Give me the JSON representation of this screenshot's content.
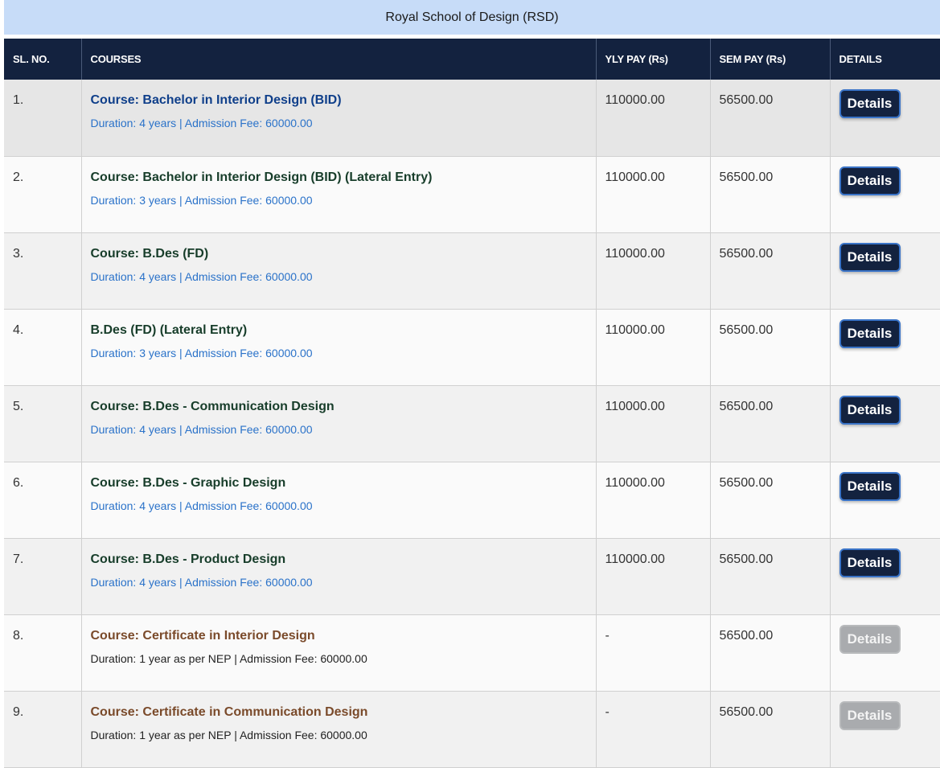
{
  "page": {
    "title": "Royal School of Design (RSD)"
  },
  "table": {
    "headers": [
      "SL. NO.",
      "COURSES",
      "YLY PAY (Rs)",
      "SEM PAY (Rs)",
      "DETAILS"
    ],
    "details_label": "Details",
    "rows": [
      {
        "sl": "1.",
        "course": "Course: Bachelor in Interior Design (BID)",
        "info": "Duration: 4 years | Admission Fee: 60000.00",
        "yly": "110000.00",
        "sem": "56500.00",
        "enabled": true
      },
      {
        "sl": "2.",
        "course": "Course: Bachelor in Interior Design (BID) (Lateral Entry)",
        "info": "Duration: 3 years | Admission Fee: 60000.00",
        "yly": "110000.00",
        "sem": "56500.00",
        "enabled": true
      },
      {
        "sl": "3.",
        "course": "Course: B.Des (FD)",
        "info": "Duration: 4 years | Admission Fee: 60000.00",
        "yly": "110000.00",
        "sem": "56500.00",
        "enabled": true
      },
      {
        "sl": "4.",
        "course": "B.Des (FD) (Lateral Entry)",
        "info": "Duration: 3 years | Admission Fee: 60000.00",
        "yly": "110000.00",
        "sem": "56500.00",
        "enabled": true
      },
      {
        "sl": "5.",
        "course": "Course: B.Des - Communication Design",
        "info": "Duration: 4 years | Admission Fee: 60000.00",
        "yly": "110000.00",
        "sem": "56500.00",
        "enabled": true
      },
      {
        "sl": "6.",
        "course": "Course: B.Des - Graphic Design",
        "info": "Duration: 4 years | Admission Fee: 60000.00",
        "yly": "110000.00",
        "sem": "56500.00",
        "enabled": true
      },
      {
        "sl": "7.",
        "course": "Course: B.Des - Product Design",
        "info": "Duration: 4 years | Admission Fee: 60000.00",
        "yly": "110000.00",
        "sem": "56500.00",
        "enabled": true
      },
      {
        "sl": "8.",
        "course": "Course: Certificate in Interior Design",
        "info": "Duration: 1 year as per NEP | Admission Fee: 60000.00",
        "yly": "-",
        "sem": "56500.00",
        "enabled": false
      },
      {
        "sl": "9.",
        "course": "Course: Certificate in Communication Design",
        "info": "Duration: 1 year as per NEP | Admission Fee: 60000.00",
        "yly": "-",
        "sem": "56500.00",
        "enabled": false
      }
    ]
  },
  "colors": {
    "header_bg": "#13223f",
    "title_bg": "#c7dcf8",
    "course_green": "#173d2a",
    "course_blue": "#0f3f8a",
    "course_brown": "#7a4a2a",
    "info_link": "#2a72c9",
    "button_disabled": "#a9abae"
  }
}
